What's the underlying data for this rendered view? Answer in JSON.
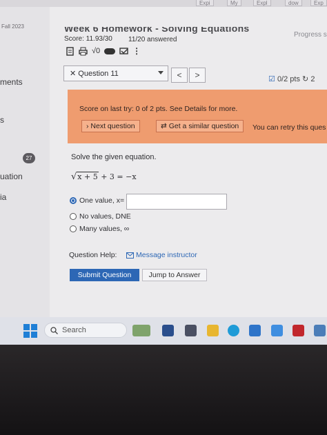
{
  "browser": {
    "tabs": [
      "Expi",
      "My",
      "Expl",
      "dow",
      "Exp"
    ]
  },
  "sidebar": {
    "term": "Fall 2023",
    "items": [
      "ments",
      "s",
      "uation",
      "ia"
    ],
    "badge": "27"
  },
  "header": {
    "title": "Week 6 Homework - Solving Equations",
    "progress_link": "Progress s",
    "score": "Score: 11.93/30",
    "answered": "11/20 answered",
    "math_tool_label": "√0"
  },
  "question_nav": {
    "selected": "✕ Question 11",
    "prev": "<",
    "next": ">",
    "points": "0/2 pts",
    "retries": "2"
  },
  "notice": {
    "score_text": "Score on last try: 0 of 2 pts. See Details for more.",
    "next_button": "› Next question",
    "similar_button": "Get a similar question",
    "retry_text": "You can retry this ques"
  },
  "question": {
    "prompt": "Solve the given equation.",
    "equation": {
      "radicand": "x + 5",
      "rest": " + 3 = −x"
    },
    "options": [
      {
        "label": "One value, x=",
        "selected": true
      },
      {
        "label": "No values, DNE",
        "selected": false
      },
      {
        "label": "Many values, ∞",
        "selected": false
      }
    ],
    "answer_value": ""
  },
  "help": {
    "label": "Question Help:",
    "message_link": "Message instructor"
  },
  "actions": {
    "submit": "Submit Question",
    "jump": "Jump to Answer"
  },
  "taskbar": {
    "search_placeholder": "Search"
  },
  "colors": {
    "accent": "#2d67b5",
    "notice_bg": "#ef9c6f"
  }
}
